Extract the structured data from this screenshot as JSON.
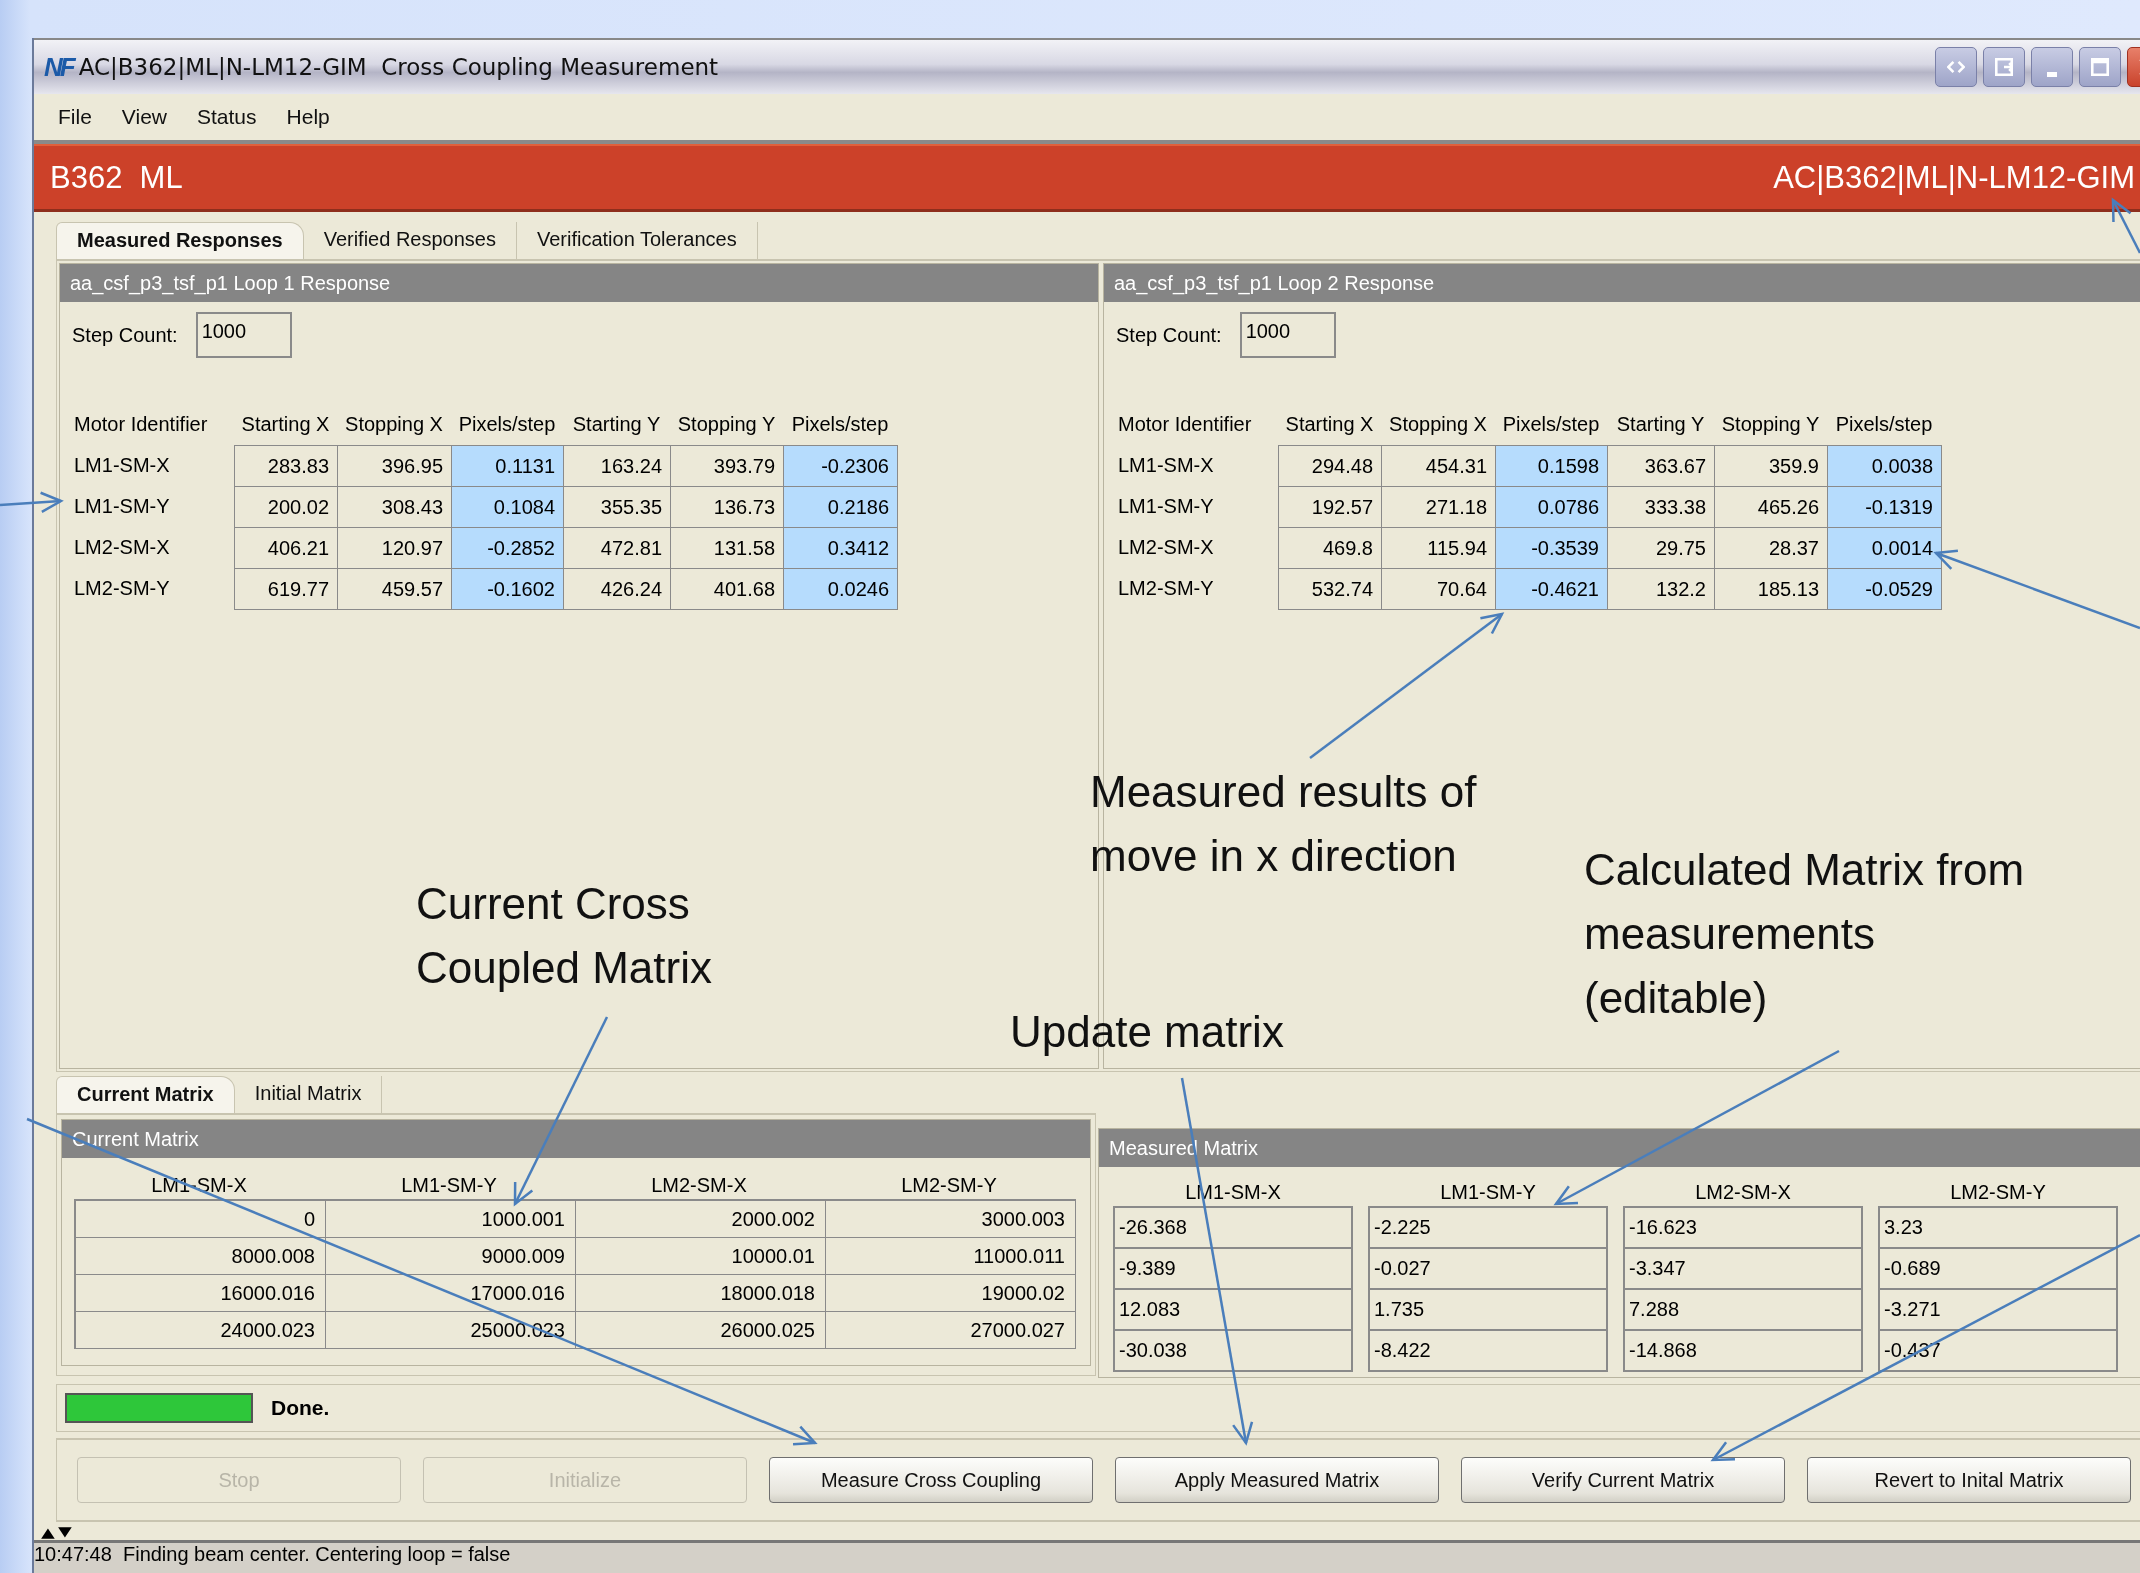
{
  "window": {
    "logo": "NF",
    "title": "AC|B362|ML|N-LM12-GIM  Cross Coupling Measurement"
  },
  "menu": [
    "File",
    "View",
    "Status",
    "Help"
  ],
  "banner": {
    "left": "B362  ML",
    "right": "AC|B362|ML|N-LM12-GIM"
  },
  "tabs": [
    {
      "label": "Measured Responses",
      "selected": true
    },
    {
      "label": "Verified Responses",
      "selected": false
    },
    {
      "label": "Verification Tolerances",
      "selected": false
    }
  ],
  "loops": [
    {
      "title": "aa_csf_p3_tsf_p1 Loop 1 Response",
      "step_label": "Step Count:",
      "step_count": "1000",
      "columns": [
        {
          "label": "Motor Identifier",
          "highlighted": false
        },
        {
          "label": "Starting X",
          "highlighted": false
        },
        {
          "label": "Stopping X",
          "highlighted": false
        },
        {
          "label": "Pixels/step",
          "highlighted": true
        },
        {
          "label": "Starting Y",
          "highlighted": false
        },
        {
          "label": "Stopping Y",
          "highlighted": false
        },
        {
          "label": "Pixels/step",
          "highlighted": true
        }
      ],
      "rows": [
        [
          "LM1-SM-X",
          "283.83",
          "396.95",
          "0.1131",
          "163.24",
          "393.79",
          "-0.2306"
        ],
        [
          "LM1-SM-Y",
          "200.02",
          "308.43",
          "0.1084",
          "355.35",
          "136.73",
          "0.2186"
        ],
        [
          "LM2-SM-X",
          "406.21",
          "120.97",
          "-0.2852",
          "472.81",
          "131.58",
          "0.3412"
        ],
        [
          "LM2-SM-Y",
          "619.77",
          "459.57",
          "-0.1602",
          "426.24",
          "401.68",
          "0.0246"
        ]
      ]
    },
    {
      "title": "aa_csf_p3_tsf_p1 Loop 2 Response",
      "step_label": "Step Count:",
      "step_count": "1000",
      "columns": [
        {
          "label": "Motor Identifier",
          "highlighted": false
        },
        {
          "label": "Starting X",
          "highlighted": false
        },
        {
          "label": "Stopping X",
          "highlighted": false
        },
        {
          "label": "Pixels/step",
          "highlighted": true
        },
        {
          "label": "Starting Y",
          "highlighted": false
        },
        {
          "label": "Stopping Y",
          "highlighted": false
        },
        {
          "label": "Pixels/step",
          "highlighted": true
        }
      ],
      "rows": [
        [
          "LM1-SM-X",
          "294.48",
          "454.31",
          "0.1598",
          "363.67",
          "359.9",
          "0.0038"
        ],
        [
          "LM1-SM-Y",
          "192.57",
          "271.18",
          "0.0786",
          "333.38",
          "465.26",
          "-0.1319"
        ],
        [
          "LM2-SM-X",
          "469.8",
          "115.94",
          "-0.3539",
          "29.75",
          "28.37",
          "0.0014"
        ],
        [
          "LM2-SM-Y",
          "532.74",
          "70.64",
          "-0.4621",
          "132.2",
          "185.13",
          "-0.0529"
        ]
      ]
    }
  ],
  "matrix_tabs": [
    {
      "label": "Current Matrix",
      "selected": true
    },
    {
      "label": "Initial Matrix",
      "selected": false
    }
  ],
  "current_matrix": {
    "title": "Current Matrix",
    "columns": [
      "LM1-SM-X",
      "LM1-SM-Y",
      "LM2-SM-X",
      "LM2-SM-Y"
    ],
    "rows": [
      [
        "0",
        "1000.001",
        "2000.002",
        "3000.003"
      ],
      [
        "8000.008",
        "9000.009",
        "10000.01",
        "11000.011"
      ],
      [
        "16000.016",
        "17000.016",
        "18000.018",
        "19000.02"
      ],
      [
        "24000.023",
        "25000.023",
        "26000.025",
        "27000.027"
      ]
    ]
  },
  "measured_matrix": {
    "title": "Measured Matrix",
    "columns": [
      "LM1-SM-X",
      "LM1-SM-Y",
      "LM2-SM-X",
      "LM2-SM-Y"
    ],
    "rows": [
      [
        "-26.368",
        "-2.225",
        "-16.623",
        "3.23"
      ],
      [
        "-9.389",
        "-0.027",
        "-3.347",
        "-0.689"
      ],
      [
        "12.083",
        "1.735",
        "7.288",
        "-3.271"
      ],
      [
        "-30.038",
        "-8.422",
        "-14.868",
        "-0.437"
      ]
    ]
  },
  "progress": {
    "level": 1,
    "text": "Done."
  },
  "buttons": [
    {
      "label": "Stop",
      "disabled": true
    },
    {
      "label": "Initialize",
      "disabled": true
    },
    {
      "label": "Measure Cross Coupling",
      "disabled": false
    },
    {
      "label": "Apply Measured Matrix",
      "disabled": false
    },
    {
      "label": "Verify Current Matrix",
      "disabled": false
    },
    {
      "label": "Revert to Inital Matrix",
      "disabled": false
    }
  ],
  "status_bar": {
    "text": "10:47:48  Finding beam center. Centering loop = false"
  },
  "annotations": [
    {
      "text": "Measured results of\nmove in x direction"
    },
    {
      "text": "Current Cross\nCoupled Matrix"
    },
    {
      "text": "Calculated Matrix from\nmeasurements\n(editable)"
    },
    {
      "text": "Update matrix"
    }
  ]
}
